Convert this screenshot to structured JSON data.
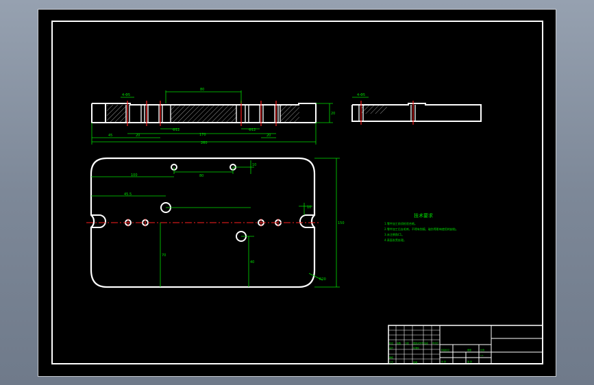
{
  "colors": {
    "background": "#000000",
    "outline": "#ffffff",
    "dimension": "#00ff00",
    "centerline": "#ff0000",
    "hatch": "#ffffff",
    "window": "#8591a1"
  },
  "front_view": {
    "dims": {
      "top": "80",
      "left_callout": "4-Φ5",
      "height": "20",
      "bottom_1": "45",
      "bottom_2": "20",
      "bottom_3": "Φ12",
      "bottom_4": "Φ12",
      "bottom_5": "20",
      "overall_inner": "170",
      "overall": "260"
    }
  },
  "side_view": {
    "dims": {
      "callout": "4-Φ5"
    }
  },
  "plan_view": {
    "dims": {
      "top_pitch": "80",
      "top_offset": "10",
      "left_span": "100",
      "left_short": "45.5",
      "right_height": "150",
      "right_small": "10",
      "vertical_1": "70",
      "vertical_2": "40",
      "radius": "R20"
    }
  },
  "tech_req": {
    "title": "技术要求",
    "lines": [
      "1.零件加工前须检验合格。",
      "2.零件加工后去毛刺，不得有划痕、碰伤等影响使用的缺陷。",
      "3.未注倒角C1。",
      "4.表面发黑处理。"
    ]
  },
  "title_block": {
    "cells": [
      "标记",
      "处数",
      "分区",
      "更改文件号",
      "签名",
      "年月日",
      "设计",
      "标准化",
      "阶段标记",
      "重量",
      "比例",
      "审核",
      "工艺",
      "批准",
      "共 张",
      "第 张",
      "1:1"
    ]
  }
}
